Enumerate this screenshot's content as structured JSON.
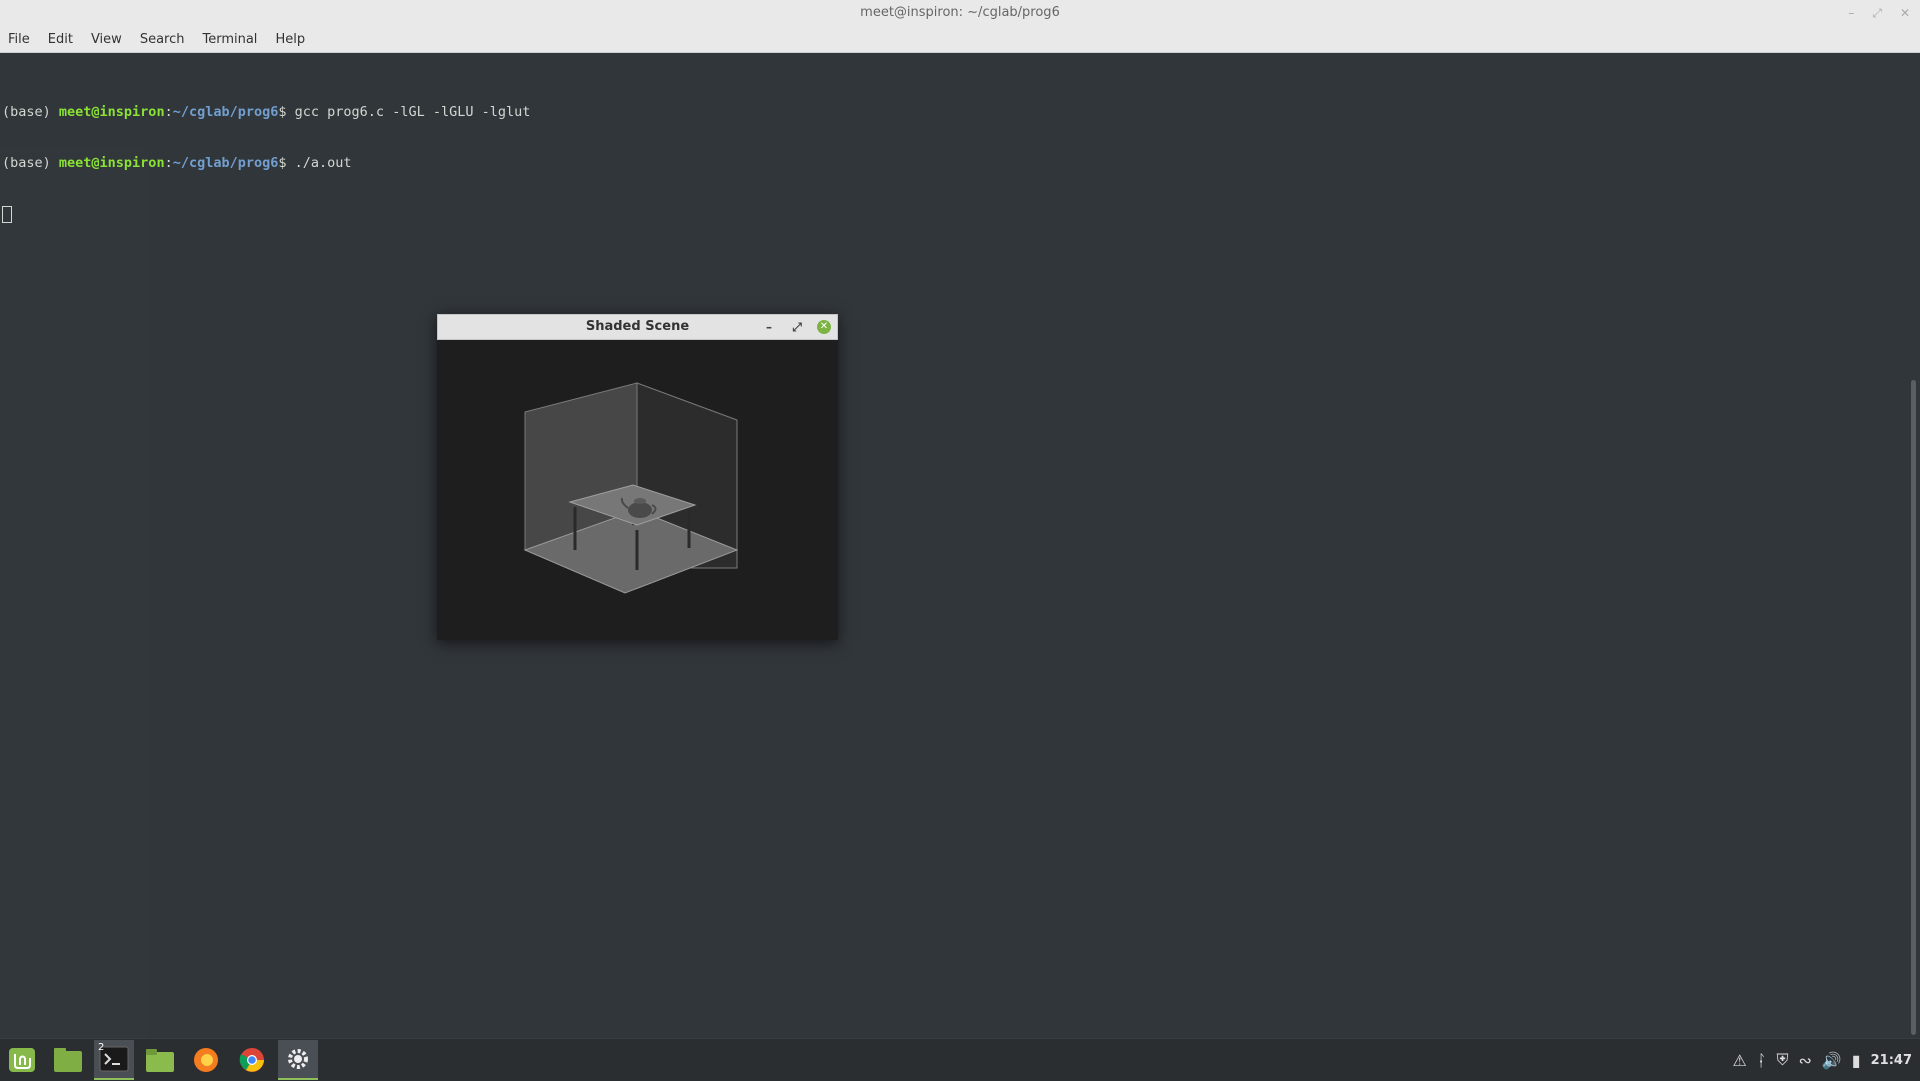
{
  "terminal": {
    "title": "meet@inspiron: ~/cglab/prog6",
    "menu": [
      "File",
      "Edit",
      "View",
      "Search",
      "Terminal",
      "Help"
    ],
    "lines": [
      {
        "env": "(base) ",
        "user": "meet@inspiron",
        "sep": ":",
        "path": "~/cglab/prog6",
        "prompt": "$ ",
        "cmd": "gcc prog6.c -lGL -lGLU -lglut"
      },
      {
        "env": "(base) ",
        "user": "meet@inspiron",
        "sep": ":",
        "path": "~/cglab/prog6",
        "prompt": "$ ",
        "cmd": "./a.out"
      }
    ]
  },
  "gl_window": {
    "title": "Shaded Scene"
  },
  "taskbar": {
    "apps": [
      "mint-menu-icon",
      "files-green-icon",
      "terminal-icon",
      "folder-icon",
      "firefox-icon",
      "chrome-icon",
      "settings-icon"
    ],
    "terminal_badge": "2",
    "clock": "21:47",
    "tray": [
      "warning-icon",
      "bluetooth-icon",
      "shield-icon",
      "wifi-icon",
      "volume-icon",
      "battery-icon"
    ]
  },
  "colors": {
    "prompt_user": "#8ae234",
    "prompt_path": "#729fcf",
    "accent": "#8fbf5a"
  }
}
